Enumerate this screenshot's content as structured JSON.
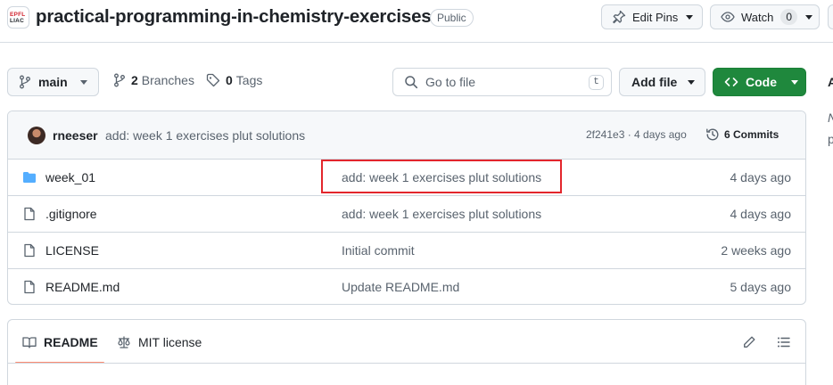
{
  "repo": {
    "org_avatar_text": [
      "EPFL",
      "LIAC"
    ],
    "name": "practical-programming-in-chemistry-exercises",
    "visibility": "Public"
  },
  "header_buttons": {
    "edit_pins": "Edit Pins",
    "watch": "Watch",
    "watch_count": "0"
  },
  "toolbar": {
    "branch": "main",
    "branches_count": "2",
    "branches_label": "Branches",
    "tags_count": "0",
    "tags_label": "Tags",
    "search_placeholder": "Go to file",
    "search_shortcut": "t",
    "add_file": "Add file",
    "code": "Code"
  },
  "latest_commit": {
    "author": "rneeser",
    "message": "add: week 1 exercises plut solutions",
    "hash_time": "2f241e3 · 4 days ago",
    "commits_count": "6 Commits"
  },
  "files": [
    {
      "type": "folder",
      "name": "week_01",
      "message": "add: week 1 exercises plut solutions",
      "date": "4 days ago"
    },
    {
      "type": "file",
      "name": ".gitignore",
      "message": "add: week 1 exercises plut solutions",
      "date": "4 days ago"
    },
    {
      "type": "file",
      "name": "LICENSE",
      "message": "Initial commit",
      "date": "2 weeks ago"
    },
    {
      "type": "file",
      "name": "README.md",
      "message": "Update README.md",
      "date": "5 days ago"
    }
  ],
  "readme_tabs": {
    "readme": "README",
    "license": "MIT license"
  },
  "sidebar_glimpse": [
    "A",
    "N",
    "p"
  ],
  "colors": {
    "primary_green": "#1f883d",
    "highlight_red": "#e3262c",
    "folder_blue": "#54aeff",
    "tab_underline": "#fd8c73"
  }
}
